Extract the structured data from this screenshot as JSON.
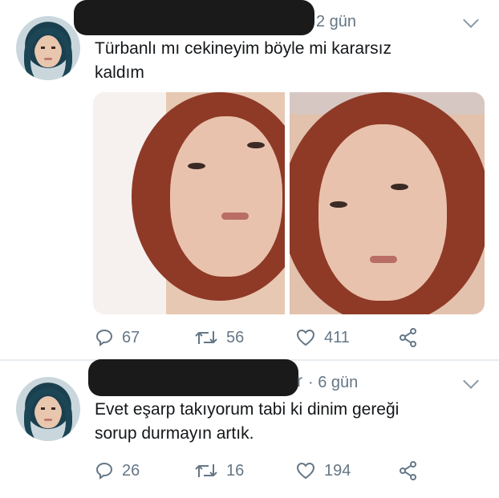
{
  "tweets": [
    {
      "handle_peek": "",
      "time": "2 gün",
      "text_line1": "Türbanlı mı cekineyim böyle mi kararsız",
      "text_line2": "kaldım",
      "stats": {
        "replies": "67",
        "retweets": "56",
        "likes": "411"
      }
    },
    {
      "handle_peek": "r",
      "time": "· 6 gün",
      "text_line1": "Evet eşarp takıyorum tabi ki dinim gereği",
      "text_line2": "sorup durmayın artık.",
      "stats": {
        "replies": "26",
        "retweets": "16",
        "likes": "194"
      }
    }
  ],
  "icons": {
    "reply": "reply-icon",
    "retweet": "retweet-icon",
    "like": "heart-icon",
    "share": "share-icon",
    "menu": "chevron-down-icon"
  },
  "colors": {
    "text": "#14171a",
    "muted": "#657786",
    "divider": "#e6ecf0",
    "redaction": "#1a1a1a"
  }
}
